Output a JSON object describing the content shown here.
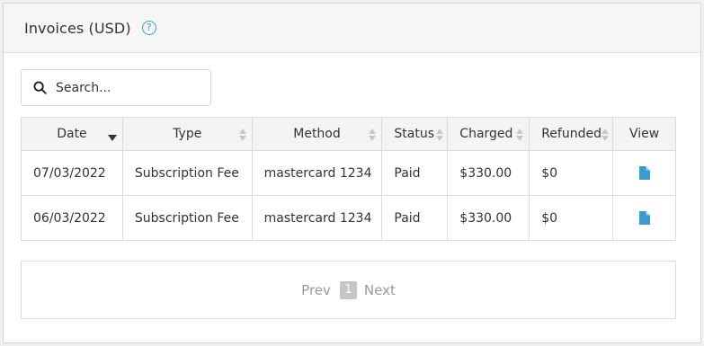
{
  "header": {
    "title": "Invoices (USD)",
    "help_glyph": "?",
    "help_icon": "question-circle-icon"
  },
  "search": {
    "placeholder": "Search...",
    "value": "",
    "icon": "search-icon"
  },
  "table": {
    "columns": [
      "Date",
      "Type",
      "Method",
      "Status",
      "Charged",
      "Refunded",
      "View"
    ],
    "sorted_column": "Date",
    "sort_direction": "descending",
    "rows": [
      {
        "date": "07/03/2022",
        "type": "Subscription Fee",
        "method": "mastercard 1234",
        "status": "Paid",
        "charged": "$330.00",
        "refunded": "$0",
        "view_icon": "document-icon"
      },
      {
        "date": "06/03/2022",
        "type": "Subscription Fee",
        "method": "mastercard 1234",
        "status": "Paid",
        "charged": "$330.00",
        "refunded": "$0",
        "view_icon": "document-icon"
      }
    ]
  },
  "pagination": {
    "prev_label": "Prev",
    "current_page": "1",
    "next_label": "Next"
  },
  "colors": {
    "accent": "#3a9bd0",
    "header_bg": "#f6f6f6",
    "border": "#dcdcdc"
  }
}
